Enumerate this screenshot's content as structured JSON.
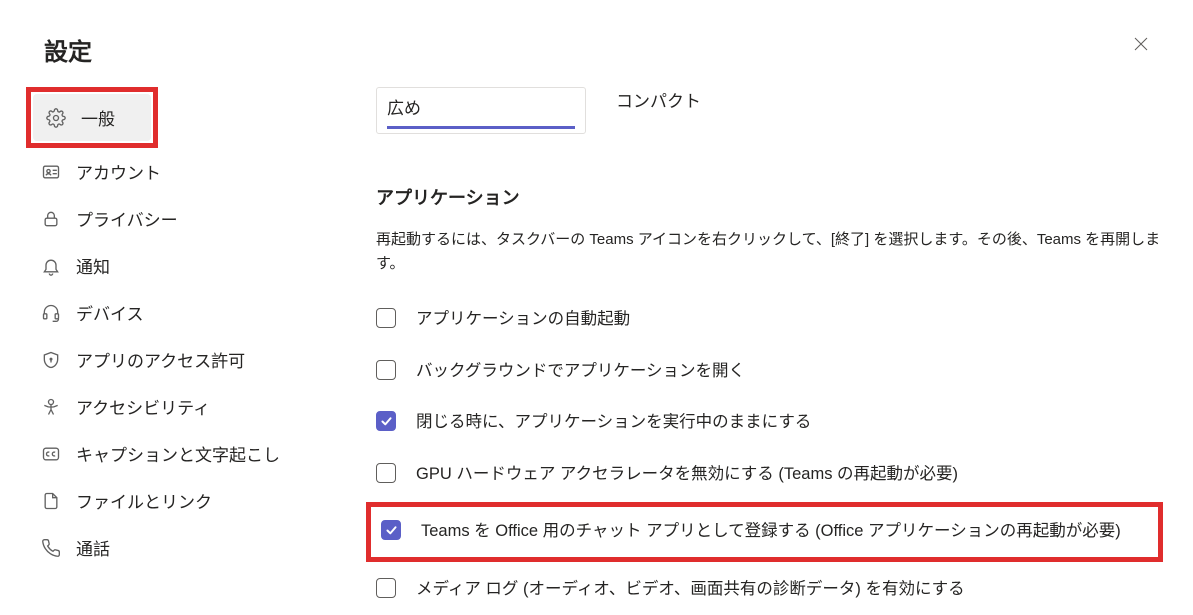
{
  "title": "設定",
  "sidebar": {
    "items": [
      {
        "id": "general",
        "label": "一般",
        "icon": "gear-icon",
        "active": true
      },
      {
        "id": "account",
        "label": "アカウント",
        "icon": "id-card-icon",
        "active": false
      },
      {
        "id": "privacy",
        "label": "プライバシー",
        "icon": "lock-icon",
        "active": false
      },
      {
        "id": "notifications",
        "label": "通知",
        "icon": "bell-icon",
        "active": false
      },
      {
        "id": "devices",
        "label": "デバイス",
        "icon": "headset-icon",
        "active": false
      },
      {
        "id": "apppermissions",
        "label": "アプリのアクセス許可",
        "icon": "shield-icon",
        "active": false
      },
      {
        "id": "accessibility",
        "label": "アクセシビリティ",
        "icon": "person-icon",
        "active": false
      },
      {
        "id": "captions",
        "label": "キャプションと文字起こし",
        "icon": "cc-icon",
        "active": false
      },
      {
        "id": "files",
        "label": "ファイルとリンク",
        "icon": "file-icon",
        "active": false
      },
      {
        "id": "calls",
        "label": "通話",
        "icon": "phone-icon",
        "active": false
      }
    ]
  },
  "density": {
    "tabs": [
      "広め",
      "コンパクト"
    ],
    "selected": 0
  },
  "app_section": {
    "title": "アプリケーション",
    "desc": "再起動するには、タスクバーの Teams アイコンを右クリックして、[終了] を選択します。その後、Teams を再開します。",
    "checks": [
      {
        "label": "アプリケーションの自動起動",
        "checked": false
      },
      {
        "label": "バックグラウンドでアプリケーションを開く",
        "checked": false
      },
      {
        "label": "閉じる時に、アプリケーションを実行中のままにする",
        "checked": true
      },
      {
        "label": "GPU ハードウェア アクセラレータを無効にする (Teams の再起動が必要)",
        "checked": false
      },
      {
        "label": "Teams を Office 用のチャット アプリとして登録する (Office アプリケーションの再起動が必要)",
        "checked": true,
        "highlight": true
      },
      {
        "label": "メディア ログ (オーディオ、ビデオ、画面共有の診断データ) を有効にする",
        "checked": false
      }
    ]
  }
}
